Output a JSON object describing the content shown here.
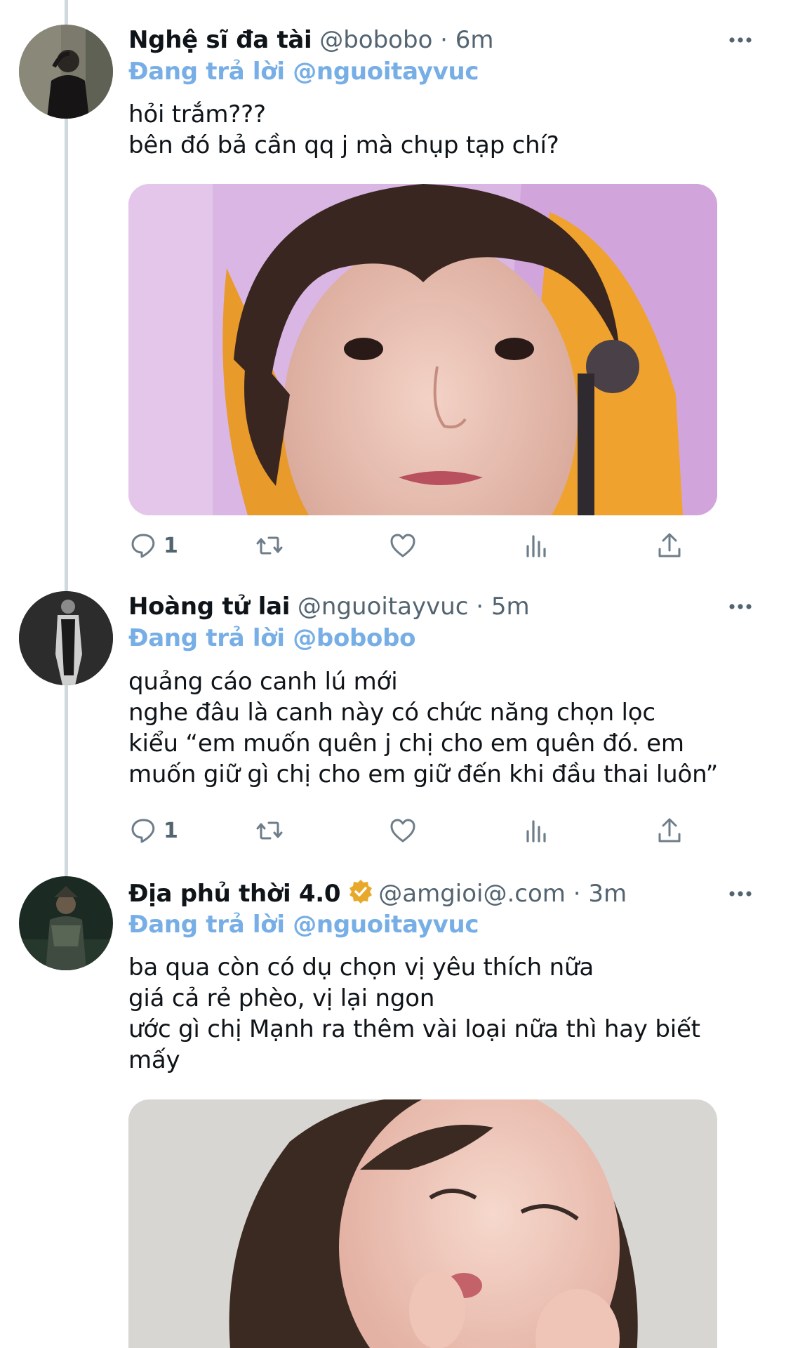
{
  "tweets": [
    {
      "name": "Nghệ sĩ đa tài",
      "handle_time": "@bobobo · 6m",
      "replying_prefix": "Đang trả lời ",
      "replying_to": "@nguoitayvuc",
      "lines": [
        "hỏi trắm???",
        "bên đó bả cần qq j mà chụp tạp chí?"
      ],
      "reply_count": "1",
      "has_media": true
    },
    {
      "name": "Hoàng tử lai",
      "handle_time": "@nguoitayvuc · 5m",
      "replying_prefix": "Đang trả lời ",
      "replying_to": "@bobobo",
      "lines": [
        "quảng cáo canh lú mới",
        "nghe đâu là canh này có chức năng chọn lọc",
        "kiểu “em muốn quên j chị cho em quên đó. em",
        "muốn giữ gì chị cho em giữ đến khi đầu thai luôn”"
      ],
      "reply_count": "1",
      "has_media": false
    },
    {
      "name": "Địa phủ thời 4.0",
      "verified": true,
      "handle_time": "@amgioi@.com · 3m",
      "replying_prefix": "Đang trả lời ",
      "replying_to": "@nguoitayvuc",
      "lines": [
        "ba qua còn có dụ chọn vị yêu thích nữa",
        "giá cả rẻ phèo, vị lại ngon",
        "ước gì chị Mạnh ra thêm vài loại nữa thì hay biết",
        "mấy"
      ],
      "has_media": true
    }
  ],
  "colors": {
    "accent": "#76aee5",
    "secondary_text": "#536471",
    "action_icon": "#6e7d8a",
    "verified_badge": "#e8a92a"
  },
  "icons": [
    "more-icon",
    "reply-icon",
    "retweet-icon",
    "like-icon",
    "views-icon",
    "share-icon",
    "verified-icon"
  ]
}
